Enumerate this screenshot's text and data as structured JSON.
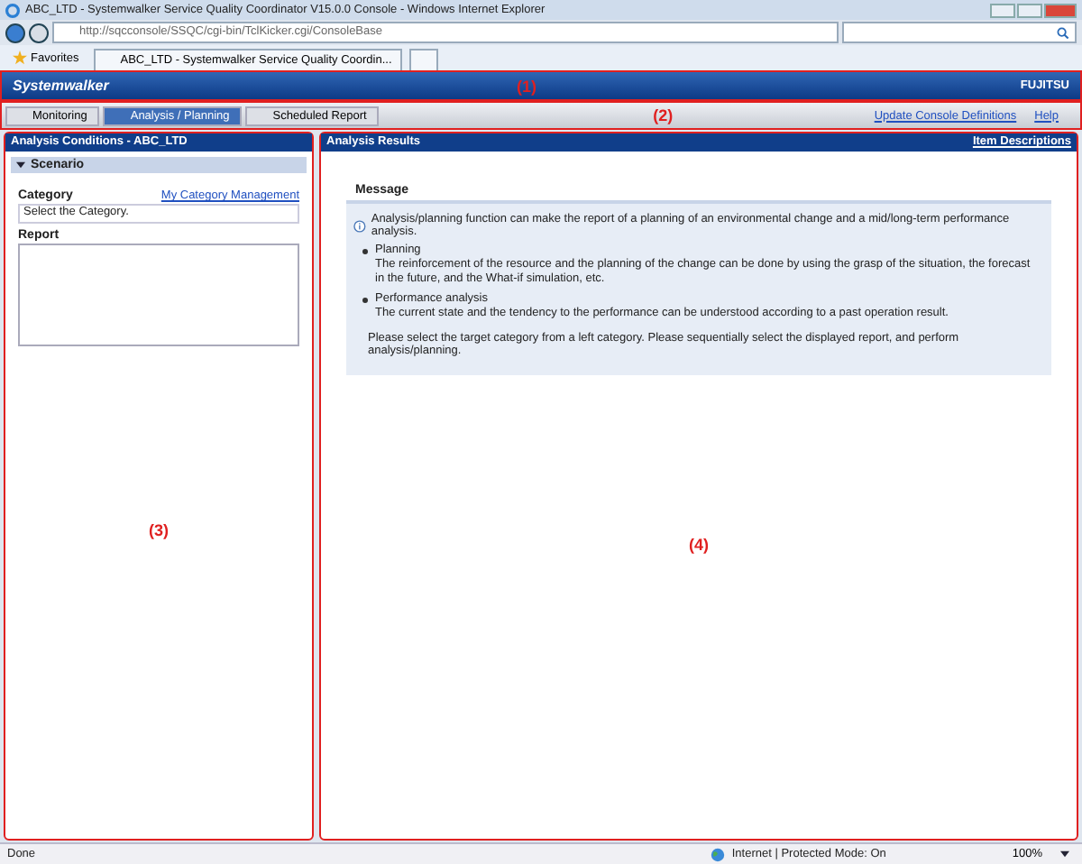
{
  "window": {
    "title": "ABC_LTD - Systemwalker Service Quality Coordinator V15.0.0 Console - Windows Internet Explorer"
  },
  "browser": {
    "address": "http://sqcconsole/SSQC/cgi-bin/TclKicker.cgi/ConsoleBase",
    "favorites": "Favorites",
    "tab_title": "ABC_LTD - Systemwalker Service Quality Coordin..."
  },
  "header": {
    "logo": "Systemwalker",
    "callout": "(1)",
    "brand": "FUJITSU"
  },
  "nav": {
    "tabs": [
      {
        "label": "Monitoring",
        "selected": false
      },
      {
        "label": "Analysis / Planning",
        "selected": true
      },
      {
        "label": "Scheduled Report",
        "selected": false
      }
    ],
    "callout": "(2)",
    "links": [
      "Update Console Definitions",
      "Help"
    ]
  },
  "left": {
    "title": "Analysis Conditions - ABC_LTD",
    "section": "Scenario",
    "category_label": "Category",
    "category_link": "My Category Management",
    "category_value": "Select the Category.",
    "report_label": "Report",
    "callout": "(3)"
  },
  "right": {
    "title": "Analysis Results",
    "link": "Item Descriptions",
    "message_title": "Message",
    "intro": "Analysis/planning function can make the report of a planning of an environmental change and a mid/long-term performance analysis.",
    "items": [
      {
        "title": "Planning",
        "text": "The reinforcement of the resource and the planning of the change can be done by using the grasp of the situation, the forecast in the future, and the What-if simulation, etc."
      },
      {
        "title": "Performance analysis",
        "text": "The current state and the tendency to the performance can be understood according to a past operation result."
      }
    ],
    "footer": "Please select the target category from a left category. Please sequentially select the displayed report, and perform analysis/planning.",
    "callout": "(4)"
  },
  "status_bar": {
    "left": "Done",
    "zone": "Internet | Protected Mode: On",
    "zoom": "100%"
  }
}
